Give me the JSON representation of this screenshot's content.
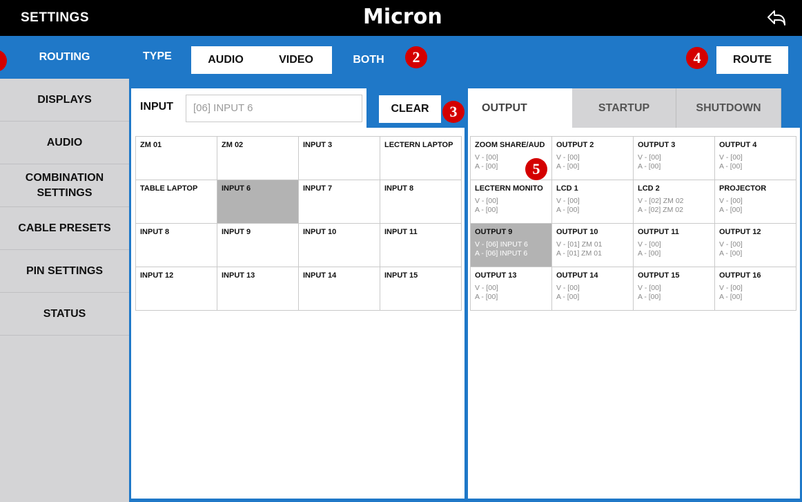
{
  "header": {
    "title": "SETTINGS",
    "logo": "Micron",
    "back_icon": "back-arrow-icon"
  },
  "sidebar": {
    "items": [
      {
        "label": "ROUTING",
        "active": true
      },
      {
        "label": "DISPLAYS"
      },
      {
        "label": "AUDIO"
      },
      {
        "label": "COMBINATION SETTINGS"
      },
      {
        "label": "CABLE PRESETS"
      },
      {
        "label": "PIN SETTINGS"
      },
      {
        "label": "STATUS"
      }
    ]
  },
  "type_bar": {
    "label": "TYPE",
    "options": [
      "AUDIO",
      "VIDEO",
      "BOTH"
    ],
    "selected": "BOTH"
  },
  "route_button": "ROUTE",
  "input": {
    "label": "INPUT",
    "value": "[06] INPUT 6",
    "clear_label": "CLEAR"
  },
  "tabs": {
    "output": "OUTPUT",
    "startup": "STARTUP",
    "shutdown": "SHUTDOWN"
  },
  "badges": [
    "2",
    "3",
    "4",
    "5"
  ],
  "inputs": [
    "ZM 01",
    "ZM 02",
    "INPUT 3",
    "LECTERN LAPTOP",
    "TABLE LAPTOP",
    "INPUT 6",
    "INPUT 7",
    "INPUT 8",
    "INPUT 8",
    "INPUT 9",
    "INPUT 10",
    "INPUT 11",
    "INPUT 12",
    "INPUT 13",
    "INPUT 14",
    "INPUT 15"
  ],
  "outputs": [
    {
      "name": "ZOOM SHARE/AUD",
      "v": "V - [00]",
      "a": "A - [00]"
    },
    {
      "name": "OUTPUT 2",
      "v": "V - [00]",
      "a": "A - [00]"
    },
    {
      "name": "OUTPUT 3",
      "v": "V - [00]",
      "a": "A - [00]"
    },
    {
      "name": "OUTPUT 4",
      "v": "V - [00]",
      "a": "A - [00]"
    },
    {
      "name": "LECTERN MONITO",
      "v": "V - [00]",
      "a": "A - [00]"
    },
    {
      "name": "LCD 1",
      "v": "V - [00]",
      "a": "A - [00]"
    },
    {
      "name": "LCD 2",
      "v": "V - [02] ZM 02",
      "a": "A - [02] ZM 02"
    },
    {
      "name": "PROJECTOR",
      "v": "V - [00]",
      "a": "A - [00]"
    },
    {
      "name": "OUTPUT 9",
      "v": "V - [06] INPUT 6",
      "a": "A - [06] INPUT 6"
    },
    {
      "name": "OUTPUT 10",
      "v": "V - [01] ZM 01",
      "a": "A - [01] ZM 01"
    },
    {
      "name": "OUTPUT 11",
      "v": "V - [00]",
      "a": "A - [00]"
    },
    {
      "name": "OUTPUT 12",
      "v": "V - [00]",
      "a": "A - [00]"
    },
    {
      "name": "OUTPUT 13",
      "v": "V - [00]",
      "a": "A - [00]"
    },
    {
      "name": "OUTPUT 14",
      "v": "V - [00]",
      "a": "A - [00]"
    },
    {
      "name": "OUTPUT 15",
      "v": "V - [00]",
      "a": "A - [00]"
    },
    {
      "name": "OUTPUT 16",
      "v": "V - [00]",
      "a": "A - [00]"
    }
  ],
  "selected_input": "INPUT 6",
  "selected_output": "OUTPUT 9",
  "colors": {
    "accent": "#1f78c8",
    "sidebar": "#d4d4d6",
    "selected_cell": "#b3b3b3",
    "badge": "#d40000"
  }
}
